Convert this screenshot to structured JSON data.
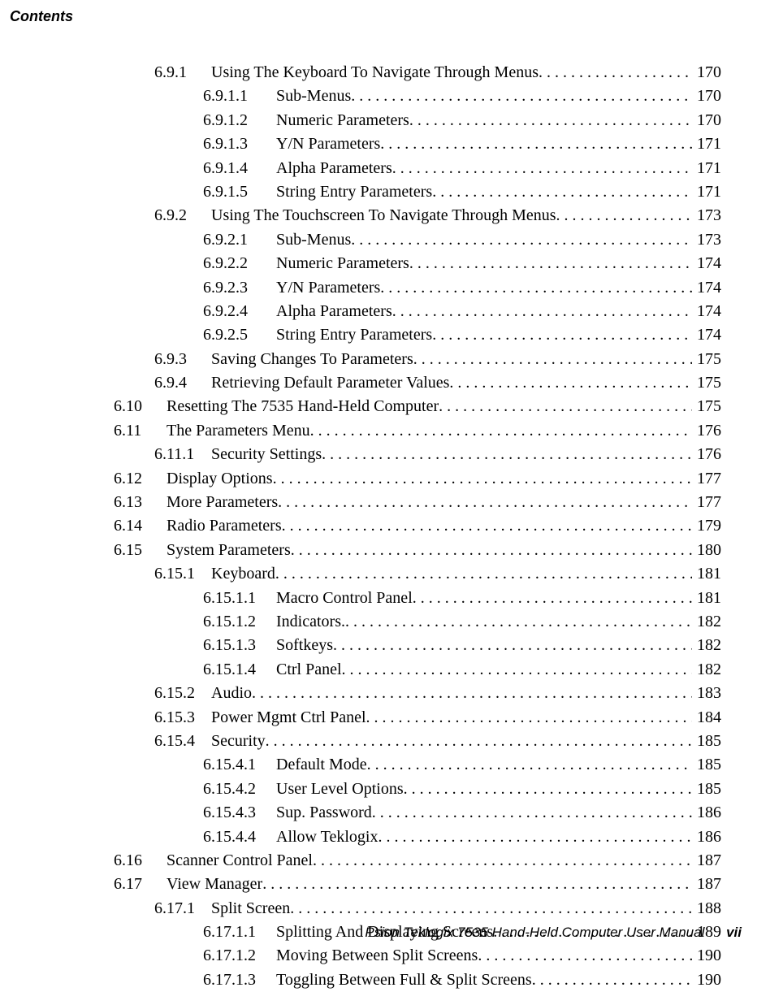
{
  "header": "Contents",
  "footer": {
    "manual": "Psion Teklogix 7535 Hand-Held Computer User Manual",
    "pageno": "vii"
  },
  "toc": [
    {
      "level": "b",
      "num": "6.9.1",
      "title": "Using The Keyboard To Navigate Through Menus",
      "page": "170"
    },
    {
      "level": "c",
      "num": "6.9.1.1",
      "title": "Sub-Menus",
      "page": "170"
    },
    {
      "level": "c",
      "num": "6.9.1.2",
      "title": "Numeric Parameters",
      "page": "170"
    },
    {
      "level": "c",
      "num": "6.9.1.3",
      "title": "Y/N Parameters",
      "page": "171"
    },
    {
      "level": "c",
      "num": "6.9.1.4",
      "title": "Alpha Parameters",
      "page": "171"
    },
    {
      "level": "c",
      "num": "6.9.1.5",
      "title": "String Entry Parameters",
      "page": "171"
    },
    {
      "level": "b",
      "num": "6.9.2",
      "title": "Using The Touchscreen To Navigate Through Menus",
      "page": "173"
    },
    {
      "level": "c",
      "num": "6.9.2.1",
      "title": "Sub-Menus",
      "page": "173"
    },
    {
      "level": "c",
      "num": "6.9.2.2",
      "title": "Numeric Parameters",
      "page": "174"
    },
    {
      "level": "c",
      "num": "6.9.2.3",
      "title": "Y/N Parameters",
      "page": "174"
    },
    {
      "level": "c",
      "num": "6.9.2.4",
      "title": "Alpha Parameters",
      "page": "174"
    },
    {
      "level": "c",
      "num": "6.9.2.5",
      "title": "String Entry Parameters",
      "page": "174"
    },
    {
      "level": "b",
      "num": "6.9.3",
      "title": "Saving Changes To Parameters",
      "page": "175"
    },
    {
      "level": "b",
      "num": "6.9.4",
      "title": "Retrieving Default Parameter Values",
      "page": "175"
    },
    {
      "level": "a",
      "num": "6.10",
      "title": "Resetting The 7535 Hand-Held Computer",
      "page": "175"
    },
    {
      "level": "a",
      "num": "6.11",
      "title": "The Parameters Menu",
      "page": "176"
    },
    {
      "level": "b",
      "num": "6.11.1",
      "title": "Security Settings",
      "page": "176"
    },
    {
      "level": "a",
      "num": "6.12",
      "title": "Display Options",
      "page": "177"
    },
    {
      "level": "a",
      "num": "6.13",
      "title": "More Parameters",
      "page": "177"
    },
    {
      "level": "a",
      "num": "6.14",
      "title": "Radio Parameters",
      "page": "179"
    },
    {
      "level": "a",
      "num": "6.15",
      "title": "System Parameters",
      "page": "180"
    },
    {
      "level": "b",
      "num": "6.15.1",
      "title": "Keyboard",
      "page": "181"
    },
    {
      "level": "c",
      "num": "6.15.1.1",
      "title": "Macro Control Panel",
      "page": "181"
    },
    {
      "level": "c",
      "num": "6.15.1.2",
      "title": "Indicators.",
      "page": "182"
    },
    {
      "level": "c",
      "num": "6.15.1.3",
      "title": "Softkeys",
      "page": "182"
    },
    {
      "level": "c",
      "num": "6.15.1.4",
      "title": "Ctrl Panel",
      "page": "182"
    },
    {
      "level": "b",
      "num": "6.15.2",
      "title": "Audio",
      "page": "183"
    },
    {
      "level": "b",
      "num": "6.15.3",
      "title": "Power Mgmt Ctrl Panel",
      "page": "184"
    },
    {
      "level": "b",
      "num": "6.15.4",
      "title": "Security",
      "page": "185"
    },
    {
      "level": "c",
      "num": "6.15.4.1",
      "title": "Default Mode",
      "page": "185"
    },
    {
      "level": "c",
      "num": "6.15.4.2",
      "title": "User Level Options",
      "page": "185"
    },
    {
      "level": "c",
      "num": "6.15.4.3",
      "title": "Sup. Password",
      "page": "186"
    },
    {
      "level": "c",
      "num": "6.15.4.4",
      "title": "Allow Teklogix",
      "page": "186"
    },
    {
      "level": "a",
      "num": "6.16",
      "title": "Scanner Control Panel",
      "page": "187"
    },
    {
      "level": "a",
      "num": "6.17",
      "title": "View Manager",
      "page": "187"
    },
    {
      "level": "b",
      "num": "6.17.1",
      "title": "Split Screen",
      "page": "188"
    },
    {
      "level": "c",
      "num": "6.17.1.1",
      "title": "Splitting And Displaying Screens",
      "page": "189"
    },
    {
      "level": "c",
      "num": "6.17.1.2",
      "title": "Moving Between Split Screens",
      "page": "190"
    },
    {
      "level": "c",
      "num": "6.17.1.3",
      "title": "Toggling Between Full & Split Screens",
      "page": "190"
    }
  ]
}
